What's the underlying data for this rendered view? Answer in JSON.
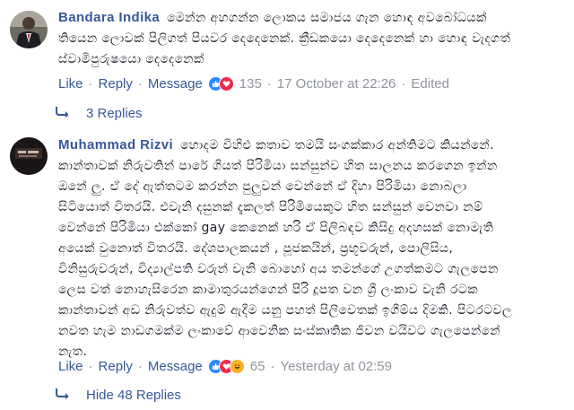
{
  "comments": [
    {
      "author": "Bandara Indika",
      "lines": [
        "මෙන්න අහගන්න ලොකය සමාජය ගැන හොඳ අවබෝධයක්",
        "තියෙන ලොවක් පිලිගත් පියවර දෙදෙනෙක්. ක්‍රීඩකයො දෙදෙනෙක් හා හොඳ වැදගත්",
        "ස්වාමිපුරුෂයො දෙදෙනෙක්"
      ],
      "actions": {
        "like": "Like",
        "reply": "Reply",
        "message": "Message"
      },
      "reaction_count": "135",
      "timestamp": "17 October at 22:26",
      "edited": "Edited",
      "replies_label": "3 Replies",
      "reactions": [
        "like-icon",
        "love-icon"
      ]
    },
    {
      "author": "Muhammad Rizvi",
      "lines": [
        "හොදම විහිළු කතාව තමයි සංගක්කාර අන්තිමට කියන්නේ.",
        "කාන්තාවක් නිරුවතින් පාරේ ගියත් පිරිමියා සන්සුන්ව හිත සාලනය කරගෙන ඉන්න",
        "ඔනේ ලු. ඒ දේ ඇත්තටම කරන්න පුලුවන් වෙන්නේ ඒ දිහා පිරිමියා නොබලා",
        "සිටියොත් විතරයි. එවැනි දසුනක් දැකලත් පිරිමියෙකුට හිත සන්සුන් වෙනවා නම්",
        "වෙන්නේ පිරිමියා එක්කෝ gay කෙනෙක් හරි ඒ පිලිබඳව කිසිදු අදහසක් නොමැති",
        "අයෙක් වුනොත් විතරයි. දේශපාලකයන් , පූජකයින්, ප්‍රභූවරුන්, පොලිසිය,",
        "විනිසුරුවරුන්, විද්‍යාල්පති වරුන් වැනි බොහෝ අය තමන්ගේ උගත්කමට ගැලපෙන",
        "ලෙස වත් නොහැසිරෙන කාමාතුරයන්ගෙන් පිරි දූපත වන ශ්‍රී ලංකාව වැනි රටක",
        "කාන්තාවන් අඩ නිරුවත්ව ඇදුම් ඇදීම යනු පහත් පිලිවෙතක් ඉගීම්ය දිමකි. පිටරටවල",
        "නවත හැම නාඩගමක්ම ලංකාවේ ආවෙනික සංස්කෘතික ජීවන වයිවට ගැලපෙන්නේ",
        "නැත."
      ],
      "actions": {
        "like": "Like",
        "reply": "Reply",
        "message": "Message"
      },
      "reaction_count": "65",
      "timestamp": "Yesterday at 02:59",
      "replies_label": "Hide 48 Replies",
      "reactions": [
        "like-icon",
        "love-icon",
        "haha-icon"
      ]
    }
  ],
  "colors": {
    "link": "#365899",
    "meta": "#90949c",
    "text": "#1d2129"
  }
}
